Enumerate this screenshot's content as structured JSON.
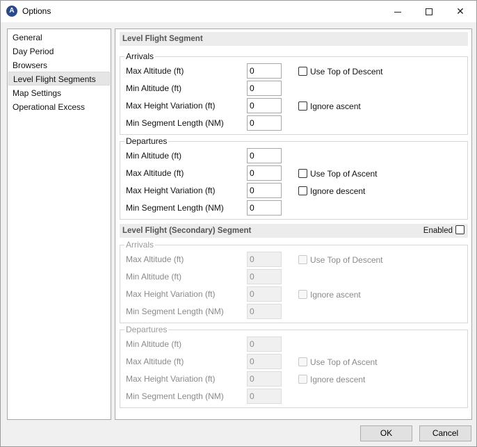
{
  "window": {
    "title": "Options",
    "app_icon": "A",
    "controls": {
      "minimize": "minimize-icon",
      "maximize": "maximize-icon",
      "close": "✕"
    }
  },
  "nav": {
    "items": [
      {
        "label": "General"
      },
      {
        "label": "Day Period"
      },
      {
        "label": "Browsers"
      },
      {
        "label": "Level Flight Segments",
        "selected": true
      },
      {
        "label": "Map Settings"
      },
      {
        "label": "Operational Excess"
      }
    ]
  },
  "primary": {
    "header": "Level Flight Segment",
    "arrivals": {
      "legend": "Arrivals",
      "max_altitude_label": "Max Altitude (ft)",
      "max_altitude_value": "0",
      "min_altitude_label": "Min Altitude (ft)",
      "min_altitude_value": "0",
      "max_height_label": "Max Height Variation (ft)",
      "max_height_value": "0",
      "min_segment_label": "Min Segment Length (NM)",
      "min_segment_value": "0",
      "use_top_label": "Use Top of Descent",
      "ignore_label": "Ignore ascent"
    },
    "departures": {
      "legend": "Departures",
      "min_altitude_label": "Min Altitude (ft)",
      "min_altitude_value": "0",
      "max_altitude_label": "Max Altitude (ft)",
      "max_altitude_value": "0",
      "max_height_label": "Max Height Variation (ft)",
      "max_height_value": "0",
      "min_segment_label": "Min Segment Length (NM)",
      "min_segment_value": "0",
      "use_top_label": "Use Top of Ascent",
      "ignore_label": "Ignore descent"
    }
  },
  "secondary": {
    "header": "Level Flight (Secondary) Segment",
    "enabled_label": "Enabled",
    "arrivals": {
      "legend": "Arrivals",
      "max_altitude_label": "Max Altitude (ft)",
      "max_altitude_value": "0",
      "min_altitude_label": "Min Altitude (ft)",
      "min_altitude_value": "0",
      "max_height_label": "Max Height Variation (ft)",
      "max_height_value": "0",
      "min_segment_label": "Min Segment Length (NM)",
      "min_segment_value": "0",
      "use_top_label": "Use Top of Descent",
      "ignore_label": "Ignore ascent"
    },
    "departures": {
      "legend": "Departures",
      "min_altitude_label": "Min Altitude (ft)",
      "min_altitude_value": "0",
      "max_altitude_label": "Max Altitude (ft)",
      "max_altitude_value": "0",
      "max_height_label": "Max Height Variation (ft)",
      "max_height_value": "0",
      "min_segment_label": "Min Segment Length (NM)",
      "min_segment_value": "0",
      "use_top_label": "Use Top of Ascent",
      "ignore_label": "Ignore descent"
    }
  },
  "buttons": {
    "ok": "OK",
    "cancel": "Cancel"
  }
}
